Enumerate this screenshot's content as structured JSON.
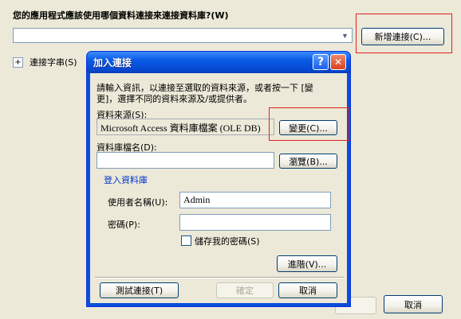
{
  "window": {
    "question": "您的應用程式應該使用哪個資料連接來連接資料庫?(W)",
    "new_connection_button": "新增連接(C)...",
    "connection_string_label": "連接字串(S)",
    "cancel_button": "取消",
    "expand_glyph": "+"
  },
  "dialog": {
    "title": "加入連接",
    "help_glyph": "?",
    "close_glyph": "✕",
    "intro_text_line1": "請輸入資訊，以連接至選取的資料來源，或者按一下 [變",
    "intro_text_line2": "更]，選擇不同的資料來源及/或提供者。",
    "data_source_label": "資料來源(S):",
    "data_source_value": "Microsoft Access 資料庫檔案 (OLE DB)",
    "change_button": "變更(C)...",
    "db_file_label": "資料庫檔名(D):",
    "db_file_value": "",
    "browse_button": "瀏覽(B)...",
    "login_section": "登入資料庫",
    "username_label": "使用者名稱(U):",
    "username_value": "Admin",
    "password_label": "密碼(P):",
    "password_value": "",
    "save_password_label": "儲存我的密碼(S)",
    "advanced_button": "進階(V)...",
    "test_button": "測試連接(T)",
    "ok_button": "確定",
    "cancel_button": "取消"
  },
  "colors": {
    "highlight_box": "#e02020",
    "link_blue": "#0033cc",
    "title_blue": "#0a5ae6",
    "close_red": "#e0442a"
  }
}
